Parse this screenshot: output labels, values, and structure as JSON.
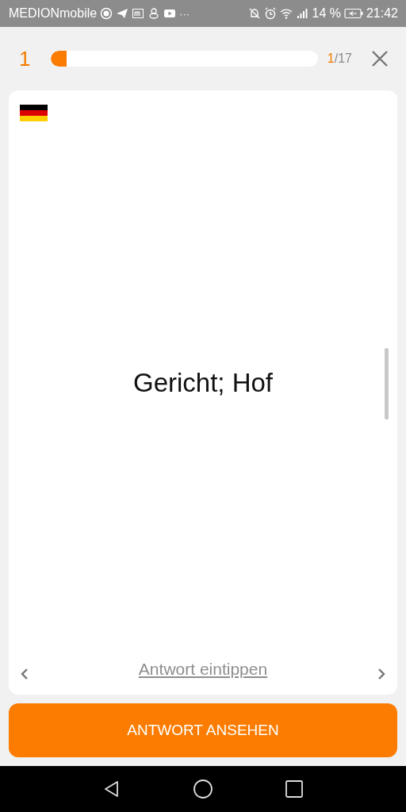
{
  "status_bar": {
    "carrier": "MEDIONmobile",
    "more": "···",
    "battery": "14 %",
    "time": "21:42"
  },
  "header": {
    "streak": "1",
    "progress": {
      "level": 0.06
    },
    "counter_current": "1",
    "counter_total": "/17"
  },
  "card": {
    "term": "Gericht; Hof",
    "type_answer_link": "Antwort eintippen"
  },
  "show_answer_button": "ANTWORT ANSEHEN"
}
